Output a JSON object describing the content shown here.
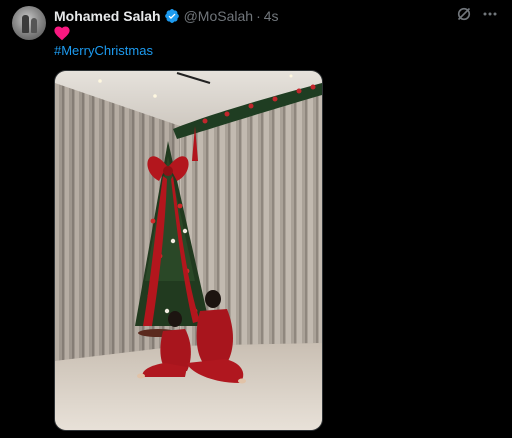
{
  "tweet": {
    "author_name": "Mohamed Salah",
    "handle": "@MoSalah",
    "separator": "·",
    "timestamp": "4s",
    "emoji": "heart",
    "hashtag": "#MerryChristmas",
    "verified": true,
    "media_alt": "Photo of two children in red pajamas sitting in front of a decorated Christmas tree"
  },
  "icons": {
    "avatar": "avatar-photo",
    "verified": "verified-badge-icon",
    "grok": "grok-icon",
    "more": "more-icon",
    "heart": "heart-emoji-icon"
  },
  "colors": {
    "background": "#000000",
    "link": "#1d9bf0",
    "verified": "#1d9bf0",
    "muted": "#71767b",
    "text": "#e7e9ea",
    "heart": "#f91880"
  }
}
